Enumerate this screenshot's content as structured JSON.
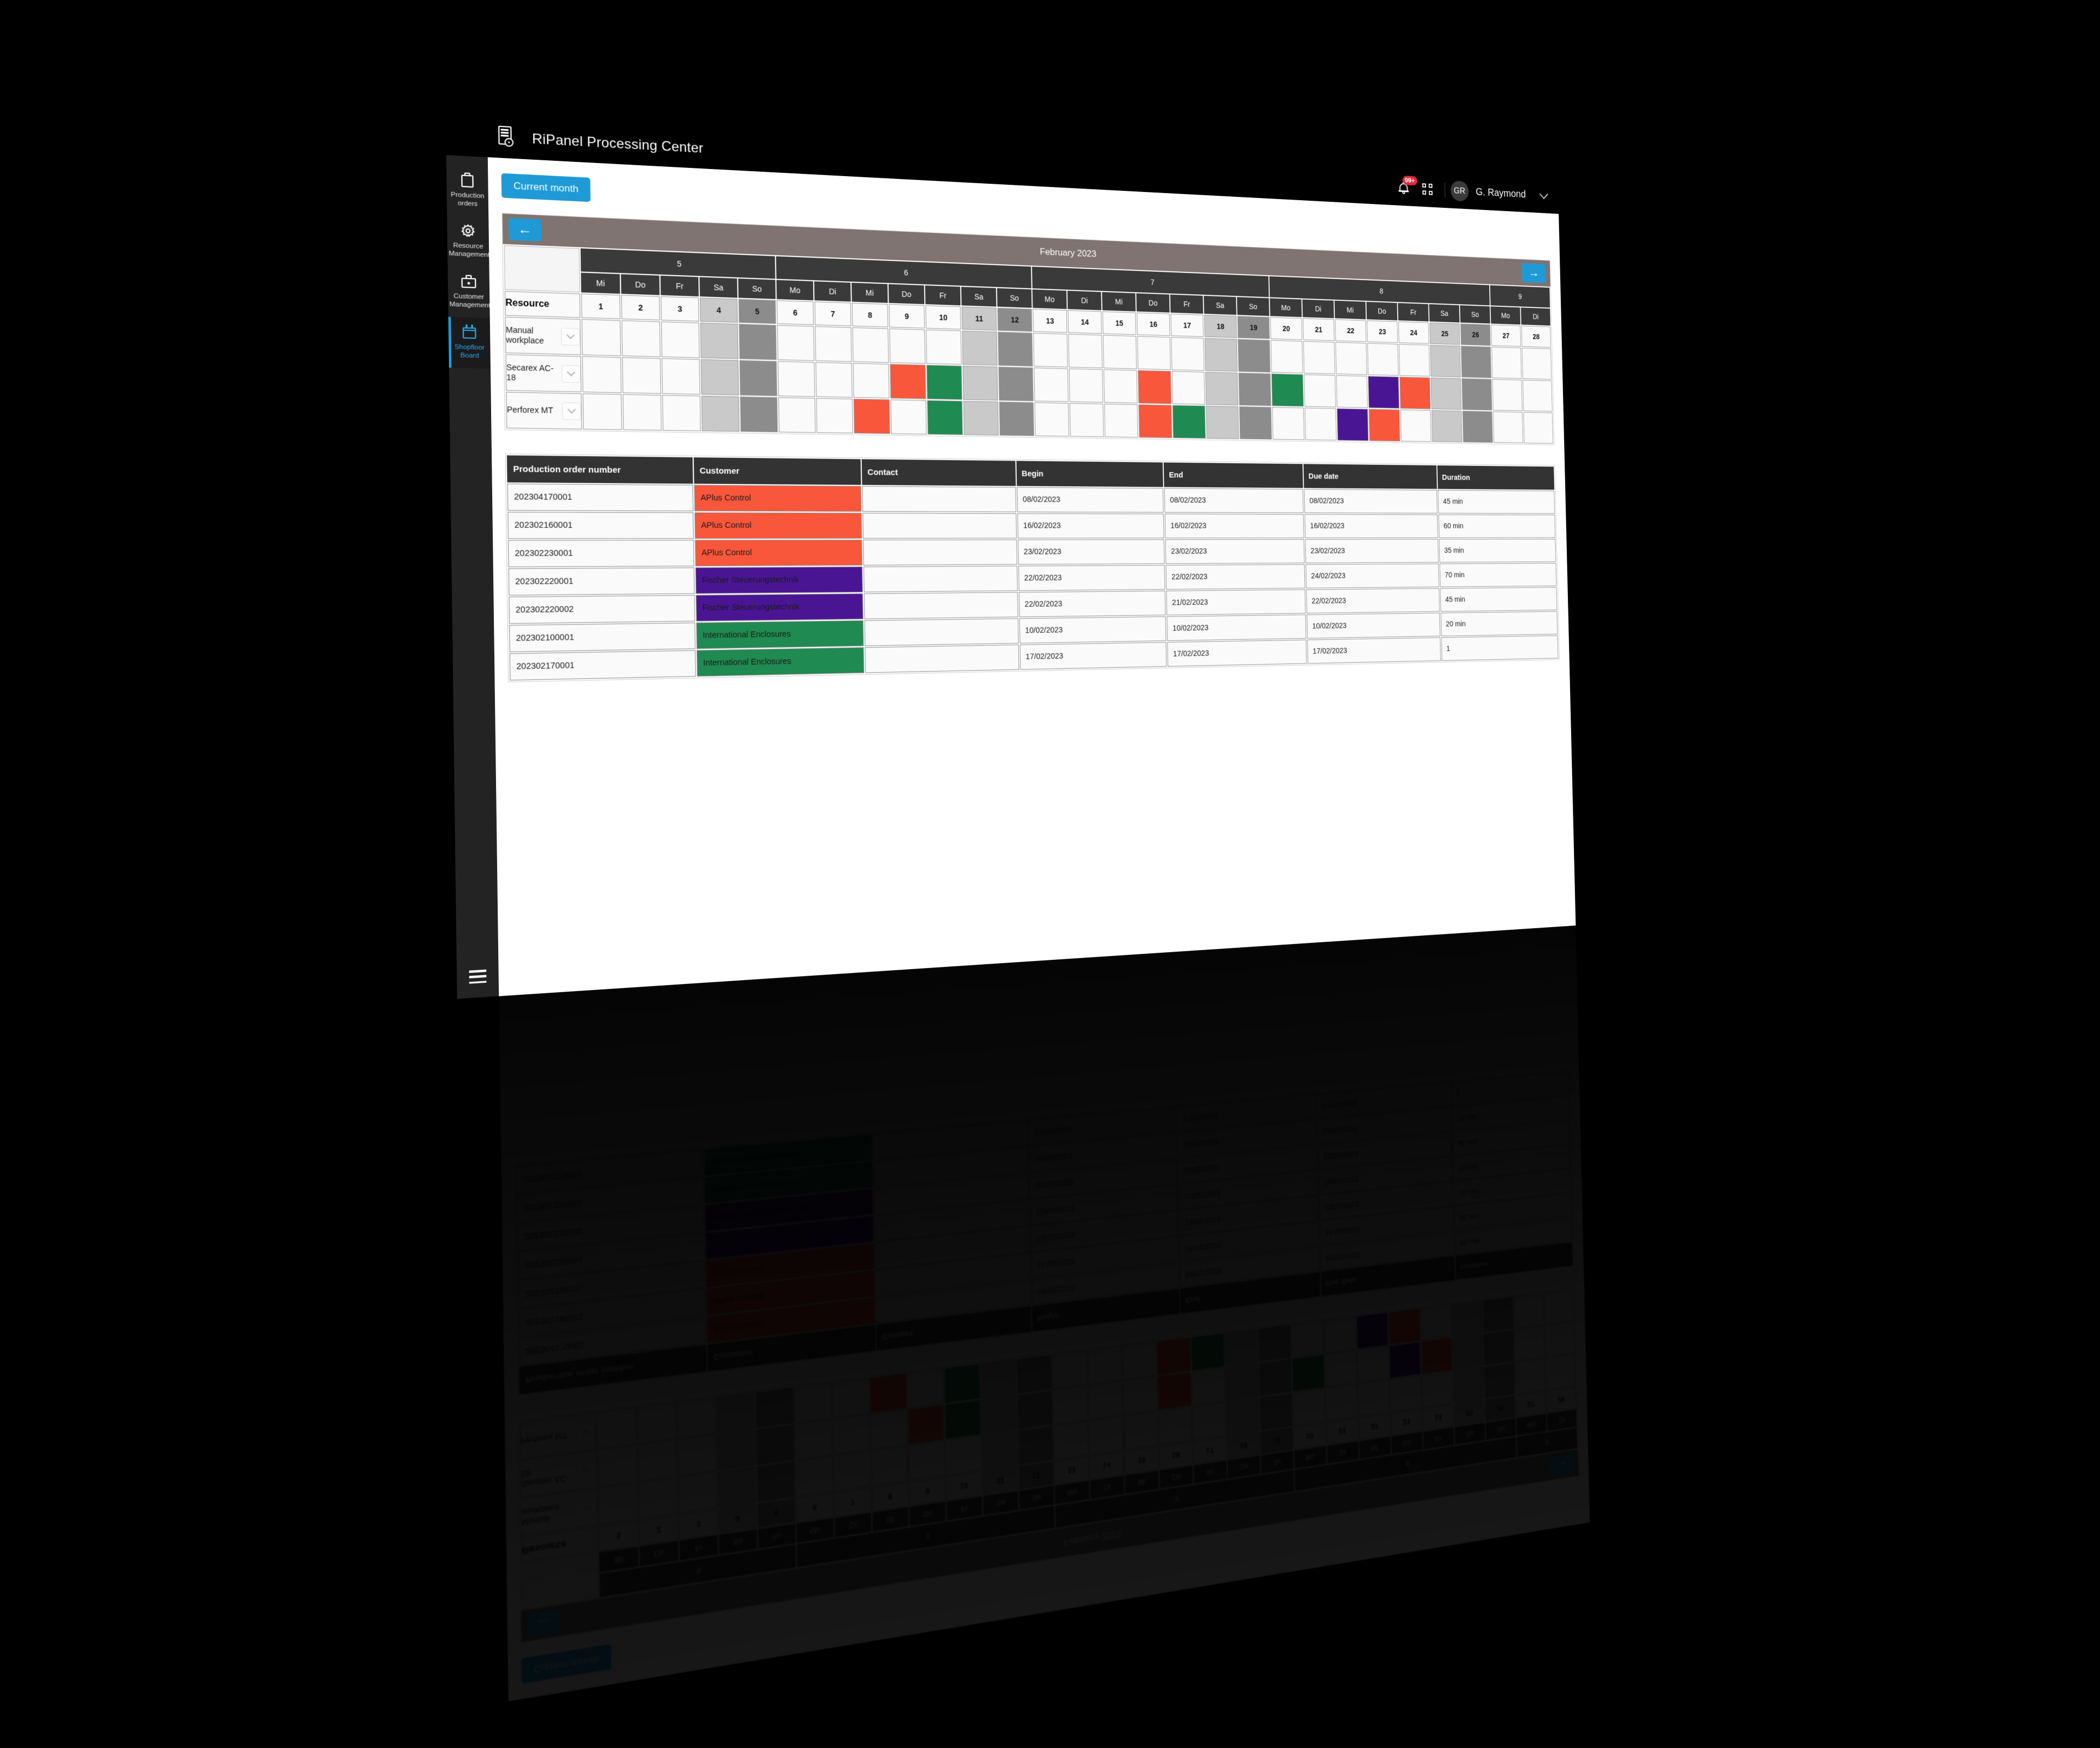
{
  "app": {
    "title": "RiPanel Processing Center",
    "brand_icon": "document-certificate-icon"
  },
  "topbar": {
    "notification_badge": "99+",
    "bell_icon": "bell-icon",
    "grid_icon": "grid-apps-icon",
    "avatar_initials": "GR",
    "user_name": "G. Raymond",
    "chevron_icon": "chevron-down-icon"
  },
  "sidebar": {
    "items": [
      {
        "label": "Production orders",
        "icon": "clipboard-icon",
        "active": false
      },
      {
        "label": "Resource Management",
        "icon": "gear-icon",
        "active": false
      },
      {
        "label": "Customer Management",
        "icon": "briefcase-icon",
        "active": false
      },
      {
        "label": "Shopfloor Board",
        "icon": "calendar-icon",
        "active": true
      }
    ],
    "menu_icon": "hamburger-menu-icon"
  },
  "toolbar": {
    "current_month_label": "Current month"
  },
  "gantt": {
    "title": "February 2023",
    "prev_label": "←",
    "next_label": "→",
    "resource_header": "Resource",
    "week_groups": [
      {
        "week": "5",
        "span": 5
      },
      {
        "week": "6",
        "span": 7
      },
      {
        "week": "7",
        "span": 7
      },
      {
        "week": "8",
        "span": 7
      },
      {
        "week": "9",
        "span": 2
      }
    ],
    "day_names": [
      "Mi",
      "Do",
      "Fr",
      "Sa",
      "So",
      "Mo",
      "Di",
      "Mi",
      "Do",
      "Fr",
      "Sa",
      "So",
      "Mo",
      "Di",
      "Mi",
      "Do",
      "Fr",
      "Sa",
      "So",
      "Mo",
      "Di",
      "Mi",
      "Do",
      "Fr",
      "Sa",
      "So",
      "Mo",
      "Di"
    ],
    "day_numbers": [
      1,
      2,
      3,
      4,
      5,
      6,
      7,
      8,
      9,
      10,
      11,
      12,
      13,
      14,
      15,
      16,
      17,
      18,
      19,
      20,
      21,
      22,
      23,
      24,
      25,
      26,
      27,
      28
    ],
    "weekend_type": [
      "",
      "",
      "",
      "sat",
      "sun",
      "",
      "",
      "",
      "",
      "",
      "sat",
      "sun",
      "",
      "",
      "",
      "",
      "",
      "sat",
      "sun",
      "",
      "",
      "",
      "",
      "",
      "sat",
      "sun",
      "",
      ""
    ],
    "rows": [
      {
        "label": "Manual workplace",
        "chevron": "chevron-down-icon",
        "cells": [
          "",
          "",
          "",
          "sat",
          "sun",
          "",
          "",
          "",
          "",
          "",
          "sat",
          "sun",
          "",
          "",
          "",
          "",
          "",
          "sat",
          "sun",
          "",
          "",
          "",
          "",
          "",
          "sat",
          "sun",
          "",
          ""
        ]
      },
      {
        "label": "Secarex AC-18",
        "chevron": "chevron-down-icon",
        "cells": [
          "",
          "",
          "",
          "sat",
          "sun",
          "",
          "",
          "",
          "red",
          "green",
          "sat",
          "sun",
          "",
          "",
          "",
          "red",
          "",
          "sat",
          "sun",
          "green",
          "",
          "",
          "purple",
          "red",
          "sat",
          "sun",
          "",
          ""
        ]
      },
      {
        "label": "Perforex MT",
        "chevron": "chevron-down-icon",
        "cells": [
          "",
          "",
          "",
          "sat",
          "sun",
          "",
          "",
          "red",
          "",
          "green",
          "sat",
          "sun",
          "",
          "",
          "",
          "red",
          "green",
          "sat",
          "sun",
          "",
          "",
          "purple",
          "red",
          "",
          "sat",
          "sun",
          "",
          ""
        ]
      }
    ]
  },
  "orders_table": {
    "columns": [
      "Production order number",
      "Customer",
      "Contact",
      "Begin",
      "End",
      "Due date",
      "Duration"
    ],
    "rows": [
      {
        "order": "202304170001",
        "customer": "APlus Control",
        "color": "red",
        "contact": "",
        "begin": "08/02/2023",
        "end": "08/02/2023",
        "due": "08/02/2023",
        "duration": "45 min"
      },
      {
        "order": "202302160001",
        "customer": "APlus Control",
        "color": "red",
        "contact": "",
        "begin": "16/02/2023",
        "end": "16/02/2023",
        "due": "16/02/2023",
        "duration": "60 min"
      },
      {
        "order": "202302230001",
        "customer": "APlus Control",
        "color": "red",
        "contact": "",
        "begin": "23/02/2023",
        "end": "23/02/2023",
        "due": "23/02/2023",
        "duration": "35 min"
      },
      {
        "order": "202302220001",
        "customer": "Fischer Steuerungstechnik",
        "color": "purple",
        "contact": "",
        "begin": "22/02/2023",
        "end": "22/02/2023",
        "due": "24/02/2023",
        "duration": "70 min"
      },
      {
        "order": "202302220002",
        "customer": "Fischer Steuerungstechnik",
        "color": "purple",
        "contact": "",
        "begin": "22/02/2023",
        "end": "21/02/2023",
        "due": "22/02/2023",
        "duration": "45 min"
      },
      {
        "order": "202302100001",
        "customer": "International Enclosures",
        "color": "green",
        "contact": "",
        "begin": "10/02/2023",
        "end": "10/02/2023",
        "due": "10/02/2023",
        "duration": "20 min"
      },
      {
        "order": "202302170001",
        "customer": "International Enclosures",
        "color": "green",
        "contact": "",
        "begin": "17/02/2023",
        "end": "17/02/2023",
        "due": "17/02/2023",
        "duration": "1"
      }
    ]
  },
  "colors": {
    "accent": "#1f9ad6",
    "task_red": "#f9573b",
    "task_green": "#1f8a51",
    "task_purple": "#4a1593",
    "header_dark": "#333333",
    "title_bar": "#7f7471"
  }
}
